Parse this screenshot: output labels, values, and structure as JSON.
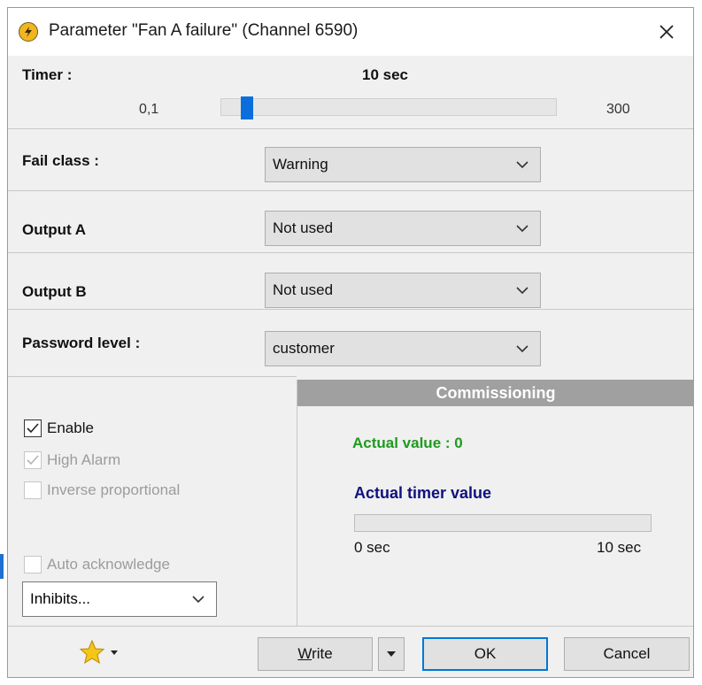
{
  "window": {
    "title": "Parameter \"Fan A failure\" (Channel 6590)",
    "icon": "lightning-icon",
    "close_icon": "close-icon"
  },
  "timer": {
    "label": "Timer :",
    "value_text": "10 sec",
    "min_label": "0,1",
    "max_label": "300",
    "min": 0.1,
    "max": 300,
    "value": 10
  },
  "fields": {
    "fail_class": {
      "label": "Fail class :",
      "value": "Warning"
    },
    "output_a": {
      "label": "Output A",
      "value": "Not used"
    },
    "output_b": {
      "label": "Output B",
      "value": "Not used"
    },
    "password_level": {
      "label": "Password level :",
      "value": "customer"
    }
  },
  "options": {
    "enable": {
      "label": "Enable",
      "checked": true,
      "enabled": true
    },
    "high_alarm": {
      "label": "High Alarm",
      "checked": true,
      "enabled": false
    },
    "inverse_proportional": {
      "label": "Inverse proportional",
      "checked": false,
      "enabled": false
    },
    "auto_acknowledge": {
      "label": "Auto acknowledge",
      "checked": false,
      "enabled": false
    }
  },
  "inhibits": {
    "value": "Inhibits..."
  },
  "commissioning": {
    "title": "Commissioning",
    "actual_value": "Actual value : 0",
    "actual_timer_title": "Actual timer value",
    "progress_fraction": 0,
    "min_label": "0 sec",
    "max_label": "10 sec",
    "colors": {
      "actual_value": "#1f9a1f",
      "timer_title": "#101080",
      "header_bg": "#a0a0a0"
    }
  },
  "footer": {
    "favorites_icon": "star-icon",
    "write_label": "Write",
    "ok_label": "OK",
    "cancel_label": "Cancel"
  }
}
